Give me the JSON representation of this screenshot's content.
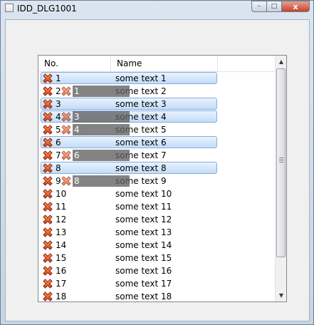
{
  "window": {
    "title": "IDD_DLG1001"
  },
  "caption": {
    "minimize": "–",
    "maximize": "□",
    "close": "x"
  },
  "list": {
    "columns": [
      "No.",
      "Name"
    ],
    "rows": [
      {
        "no": "1",
        "name": "some text 1",
        "selected": true
      },
      {
        "no": "2",
        "name": "some text 2",
        "selected": false,
        "ghost": "1"
      },
      {
        "no": "3",
        "name": "some text 3",
        "selected": true
      },
      {
        "no": "4",
        "name": "some text 4",
        "selected": true,
        "ghost": "3"
      },
      {
        "no": "5",
        "name": "some text 5",
        "selected": false,
        "ghost": "4"
      },
      {
        "no": "6",
        "name": "some text 6",
        "selected": true
      },
      {
        "no": "7",
        "name": "some text 7",
        "selected": false,
        "ghost": "6"
      },
      {
        "no": "8",
        "name": "some text 8",
        "selected": true
      },
      {
        "no": "9",
        "name": "some text 9",
        "selected": false,
        "ghost": "8"
      },
      {
        "no": "10",
        "name": "some text 10",
        "selected": false
      },
      {
        "no": "11",
        "name": "some text 11",
        "selected": false
      },
      {
        "no": "12",
        "name": "some text 12",
        "selected": false
      },
      {
        "no": "13",
        "name": "some text 13",
        "selected": false
      },
      {
        "no": "14",
        "name": "some text 14",
        "selected": false
      },
      {
        "no": "15",
        "name": "some text 15",
        "selected": false
      },
      {
        "no": "16",
        "name": "some text 16",
        "selected": false
      },
      {
        "no": "17",
        "name": "some text 17",
        "selected": false
      },
      {
        "no": "18",
        "name": "some text 18",
        "selected": false
      }
    ],
    "row_icon": "red-x-icon"
  },
  "scrollbar": {
    "up": "▲",
    "down": "▼"
  }
}
